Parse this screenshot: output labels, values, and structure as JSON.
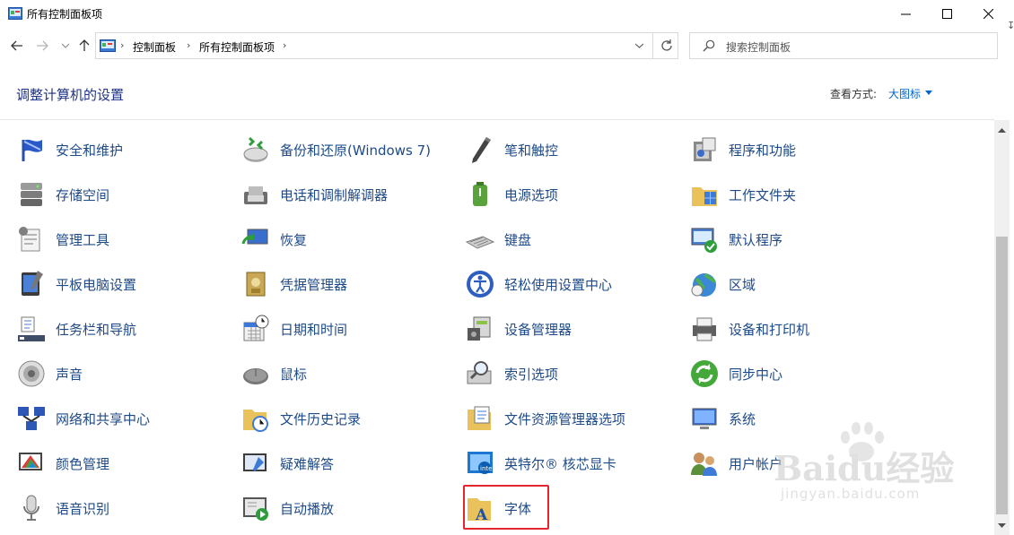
{
  "window": {
    "title": "所有控制面板项"
  },
  "address": {
    "crumbs": [
      "控制面板",
      "所有控制面板项"
    ]
  },
  "search": {
    "placeholder": "搜索控制面板"
  },
  "header": {
    "title": "调整计算机的设置",
    "view_label": "查看方式:",
    "view_value": "大图标"
  },
  "items": [
    {
      "label": "安全和维护",
      "icon": "flag-icon"
    },
    {
      "label": "备份和还原(Windows 7)",
      "icon": "backup-icon"
    },
    {
      "label": "笔和触控",
      "icon": "pen-icon"
    },
    {
      "label": "程序和功能",
      "icon": "programs-icon"
    },
    {
      "label": "存储空间",
      "icon": "storage-icon"
    },
    {
      "label": "电话和调制解调器",
      "icon": "phone-icon"
    },
    {
      "label": "电源选项",
      "icon": "power-icon"
    },
    {
      "label": "工作文件夹",
      "icon": "work-folder-icon"
    },
    {
      "label": "管理工具",
      "icon": "admin-tools-icon"
    },
    {
      "label": "恢复",
      "icon": "recovery-icon"
    },
    {
      "label": "键盘",
      "icon": "keyboard-icon"
    },
    {
      "label": "默认程序",
      "icon": "default-programs-icon"
    },
    {
      "label": "平板电脑设置",
      "icon": "tablet-icon"
    },
    {
      "label": "凭据管理器",
      "icon": "credential-icon"
    },
    {
      "label": "轻松使用设置中心",
      "icon": "ease-of-access-icon"
    },
    {
      "label": "区域",
      "icon": "region-icon"
    },
    {
      "label": "任务栏和导航",
      "icon": "taskbar-icon"
    },
    {
      "label": "日期和时间",
      "icon": "calendar-icon"
    },
    {
      "label": "设备管理器",
      "icon": "device-manager-icon"
    },
    {
      "label": "设备和打印机",
      "icon": "printer-icon"
    },
    {
      "label": "声音",
      "icon": "speaker-icon"
    },
    {
      "label": "鼠标",
      "icon": "mouse-icon"
    },
    {
      "label": "索引选项",
      "icon": "indexing-icon"
    },
    {
      "label": "同步中心",
      "icon": "sync-icon"
    },
    {
      "label": "网络和共享中心",
      "icon": "network-icon"
    },
    {
      "label": "文件历史记录",
      "icon": "file-history-icon"
    },
    {
      "label": "文件资源管理器选项",
      "icon": "explorer-options-icon"
    },
    {
      "label": "系统",
      "icon": "system-icon"
    },
    {
      "label": "颜色管理",
      "icon": "color-icon"
    },
    {
      "label": "疑难解答",
      "icon": "troubleshoot-icon"
    },
    {
      "label": "英特尔® 核芯显卡",
      "icon": "intel-graphics-icon"
    },
    {
      "label": "用户帐户",
      "icon": "users-icon"
    },
    {
      "label": "语音识别",
      "icon": "microphone-icon"
    },
    {
      "label": "自动播放",
      "icon": "autoplay-icon"
    },
    {
      "label": "字体",
      "icon": "font-icon"
    }
  ],
  "watermark": {
    "logo": "Baidu经验",
    "url": "jingyan.baidu.com"
  },
  "colors": {
    "link": "#1e4a87",
    "title": "#1e3287",
    "accent": "#0066cc",
    "highlight": "#e3262b"
  }
}
